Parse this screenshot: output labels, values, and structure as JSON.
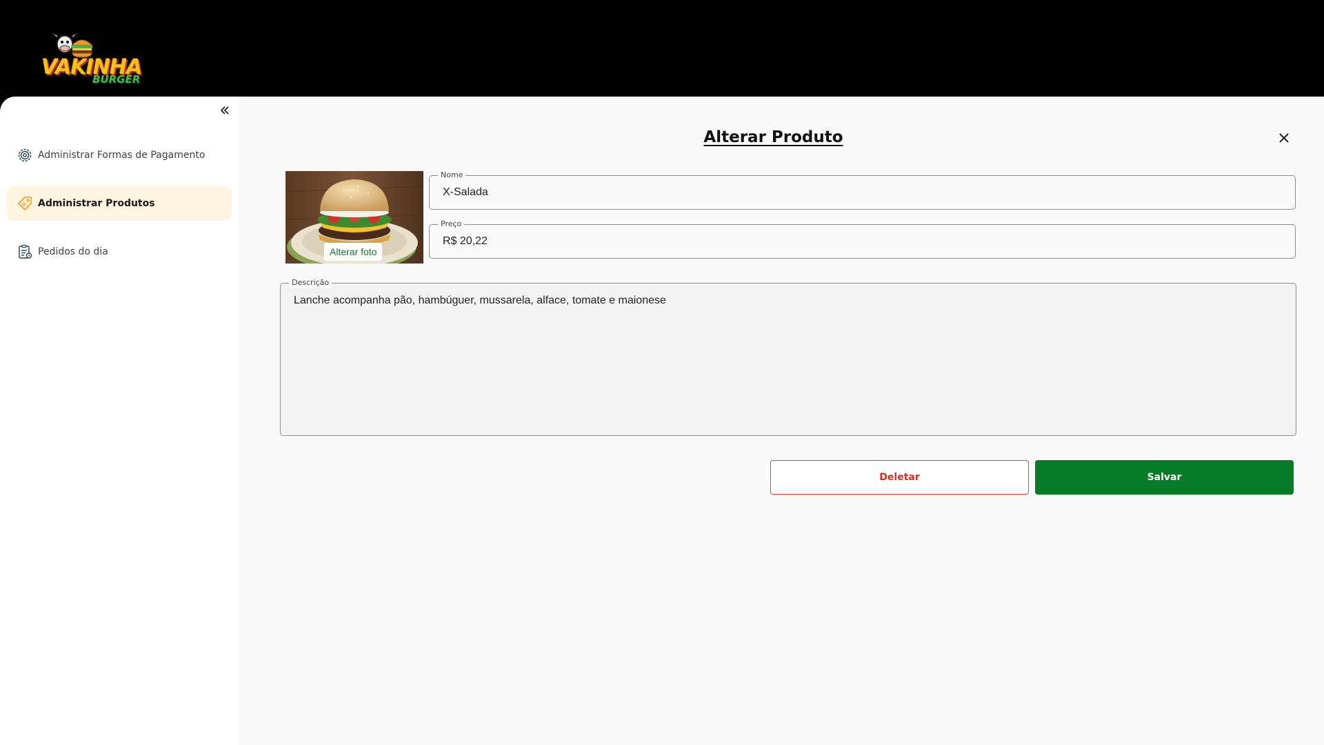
{
  "brand": {
    "logo_text": "VAKINHA",
    "logo_subtext": "BURGER"
  },
  "sidebar": {
    "items": [
      {
        "label": "Administrar Formas de Pagamento",
        "icon": "gear-icon",
        "active": false
      },
      {
        "label": "Administrar Produtos",
        "icon": "price-tag-icon",
        "active": true
      },
      {
        "label": "Pedidos do dia",
        "icon": "clipboard-list-icon",
        "active": false
      }
    ]
  },
  "form": {
    "title": "Alterar Produto",
    "photo_button": "Alterar foto",
    "nome": {
      "label": "Nome",
      "value": "X-Salada"
    },
    "preco": {
      "label": "Preço",
      "value": "R$ 20,22"
    },
    "descricao": {
      "label": "Descrição",
      "value": "Lanche acompanha pão, hambúguer, mussarela, alface, tomate e maionese"
    },
    "delete_label": "Deletar",
    "save_label": "Salvar"
  },
  "colors": {
    "accent_green": "#077b25",
    "danger_red": "#d62e24",
    "active_nav_bg": "#fff4e0",
    "header_bg": "#000000"
  }
}
